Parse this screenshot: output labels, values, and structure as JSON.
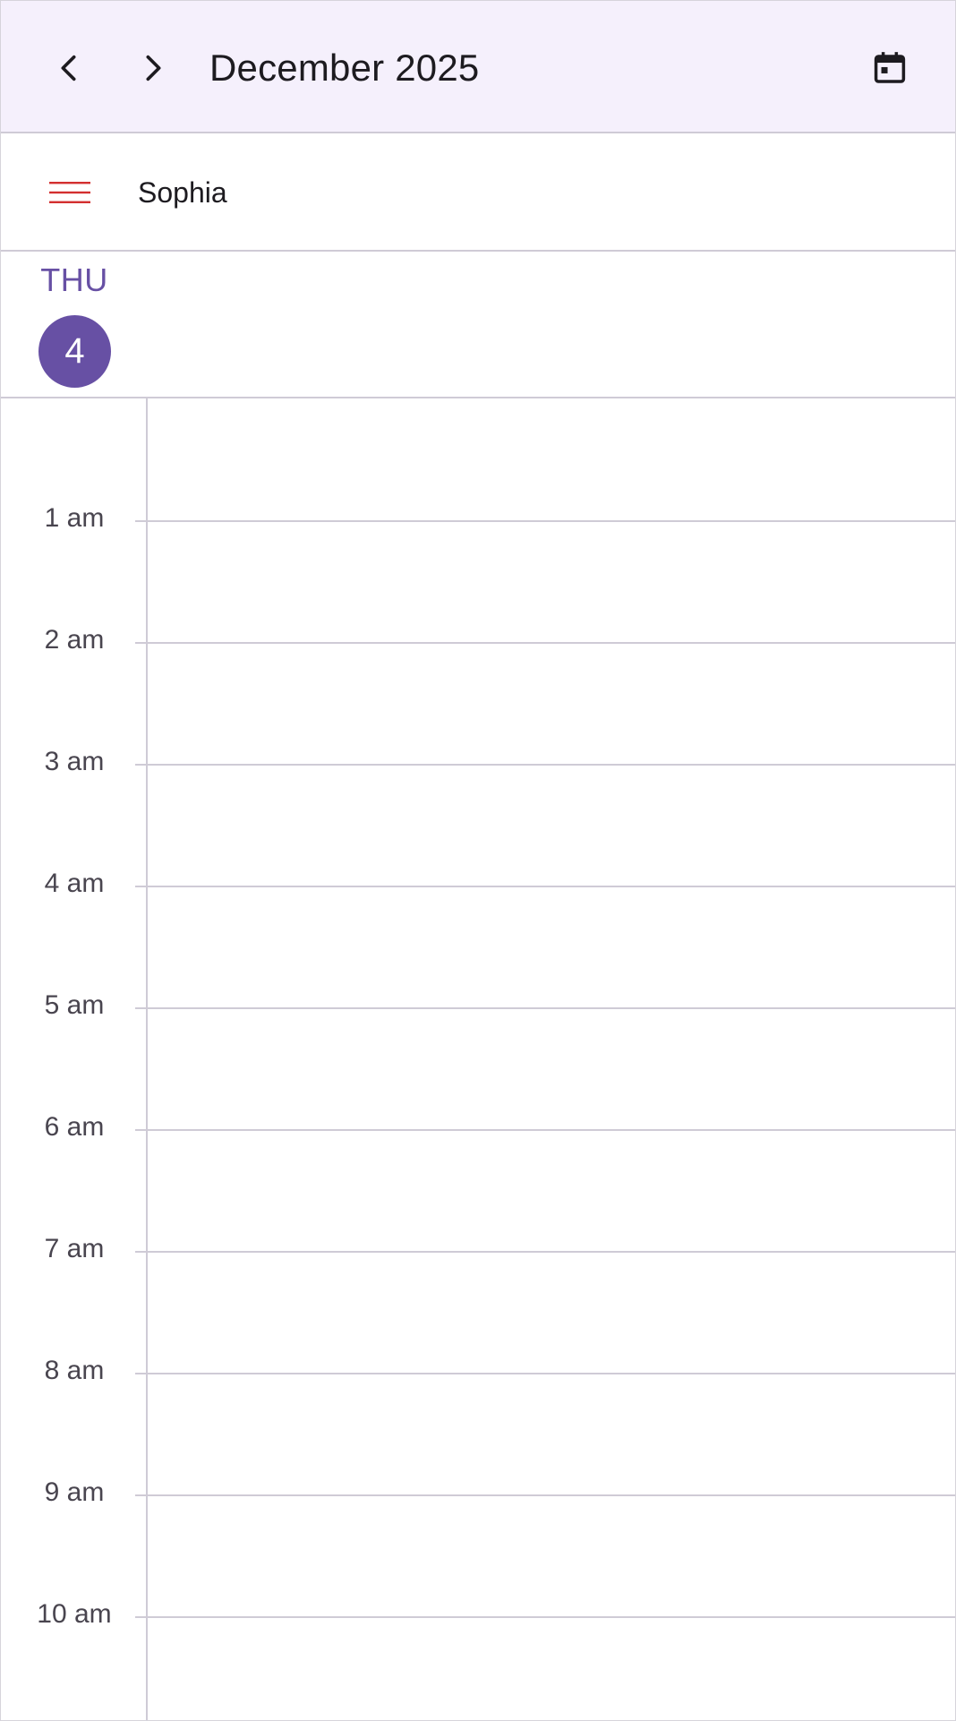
{
  "header": {
    "title": "December 2025",
    "prev_icon": "chevron-left-icon",
    "next_icon": "chevron-right-icon",
    "calendar_icon": "calendar-today-icon"
  },
  "user": {
    "name": "Sophia",
    "menu_icon": "menu-icon",
    "menu_icon_color": "#d32f2f"
  },
  "day": {
    "weekday": "THU",
    "date": "4",
    "accent_color": "#6750a4"
  },
  "timeline": {
    "hours": [
      "1 am",
      "2 am",
      "3 am",
      "4 am",
      "5 am",
      "6 am",
      "7 am",
      "8 am",
      "9 am",
      "10 am"
    ]
  }
}
